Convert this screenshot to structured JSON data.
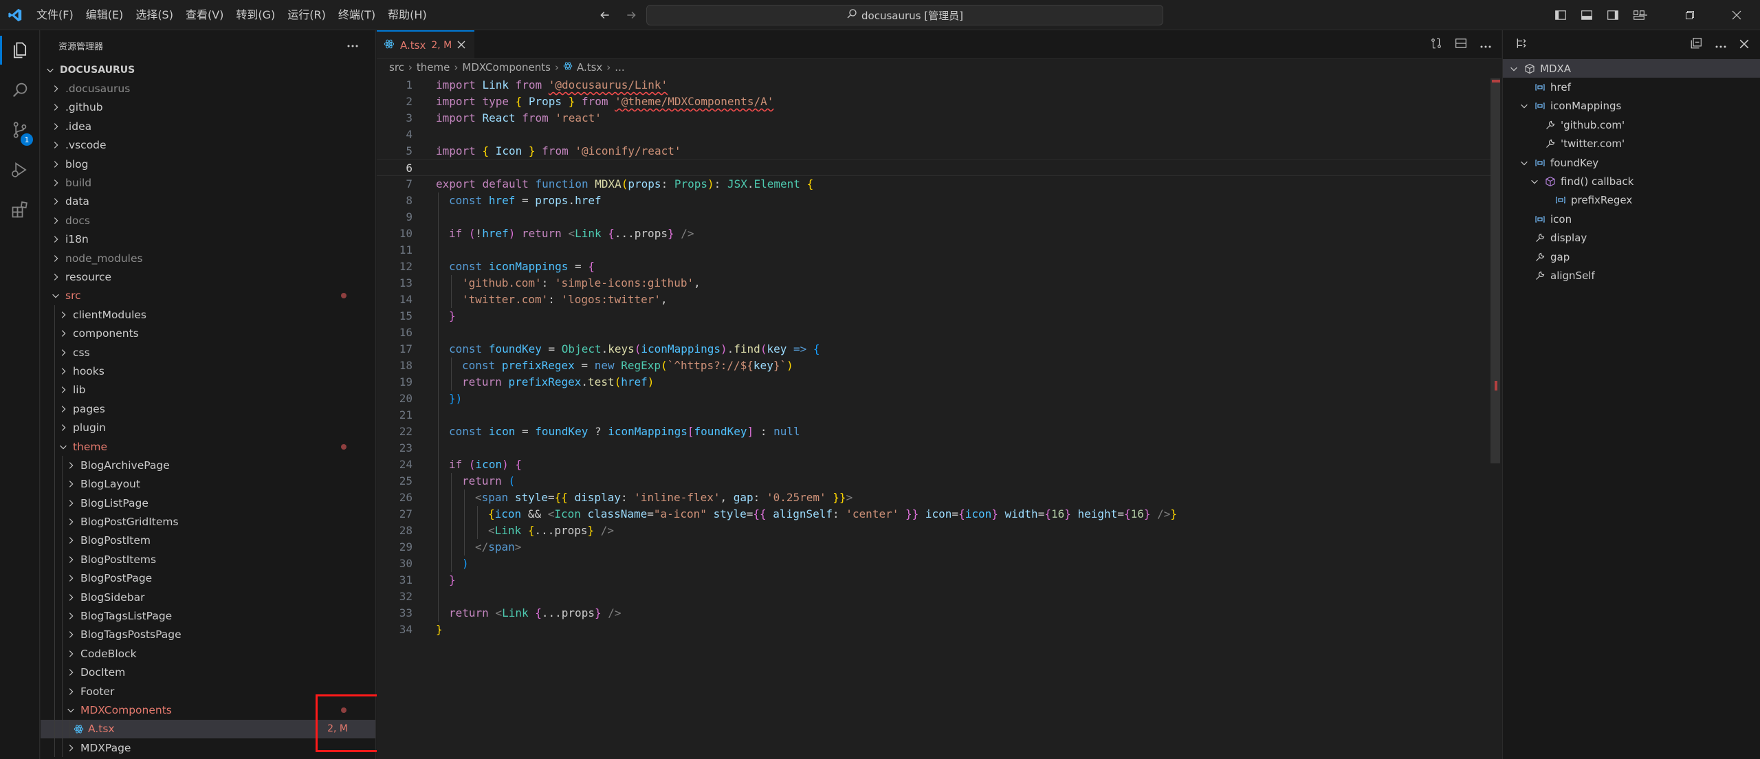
{
  "titlebar": {
    "menu": [
      "文件(F)",
      "编辑(E)",
      "选择(S)",
      "查看(V)",
      "转到(G)",
      "运行(R)",
      "终端(T)",
      "帮助(H)"
    ],
    "search": "docusaurus [管理员]"
  },
  "activity": {
    "scm_badge": "1"
  },
  "sidebar": {
    "header": "资源管理器",
    "root": "DOCUSAURUS",
    "items": [
      {
        "label": ".docusaurus",
        "depth": 1,
        "open": false,
        "dim": true
      },
      {
        "label": ".github",
        "depth": 1,
        "open": false
      },
      {
        "label": ".idea",
        "depth": 1,
        "open": false
      },
      {
        "label": ".vscode",
        "depth": 1,
        "open": false
      },
      {
        "label": "blog",
        "depth": 1,
        "open": false
      },
      {
        "label": "build",
        "depth": 1,
        "open": false,
        "dim": true
      },
      {
        "label": "data",
        "depth": 1,
        "open": false
      },
      {
        "label": "docs",
        "depth": 1,
        "open": false,
        "dim": true
      },
      {
        "label": "i18n",
        "depth": 1,
        "open": false
      },
      {
        "label": "node_modules",
        "depth": 1,
        "open": false,
        "dim": true
      },
      {
        "label": "resource",
        "depth": 1,
        "open": false
      },
      {
        "label": "src",
        "depth": 1,
        "open": true,
        "mod": true,
        "dot": true
      },
      {
        "label": "clientModules",
        "depth": 2,
        "open": false
      },
      {
        "label": "components",
        "depth": 2,
        "open": false
      },
      {
        "label": "css",
        "depth": 2,
        "open": false
      },
      {
        "label": "hooks",
        "depth": 2,
        "open": false
      },
      {
        "label": "lib",
        "depth": 2,
        "open": false
      },
      {
        "label": "pages",
        "depth": 2,
        "open": false
      },
      {
        "label": "plugin",
        "depth": 2,
        "open": false
      },
      {
        "label": "theme",
        "depth": 2,
        "open": true,
        "mod": true,
        "dot": true
      },
      {
        "label": "BlogArchivePage",
        "depth": 3,
        "open": false
      },
      {
        "label": "BlogLayout",
        "depth": 3,
        "open": false
      },
      {
        "label": "BlogListPage",
        "depth": 3,
        "open": false
      },
      {
        "label": "BlogPostGridItems",
        "depth": 3,
        "open": false
      },
      {
        "label": "BlogPostItem",
        "depth": 3,
        "open": false
      },
      {
        "label": "BlogPostItems",
        "depth": 3,
        "open": false
      },
      {
        "label": "BlogPostPage",
        "depth": 3,
        "open": false
      },
      {
        "label": "BlogSidebar",
        "depth": 3,
        "open": false
      },
      {
        "label": "BlogTagsListPage",
        "depth": 3,
        "open": false
      },
      {
        "label": "BlogTagsPostsPage",
        "depth": 3,
        "open": false
      },
      {
        "label": "CodeBlock",
        "depth": 3,
        "open": false
      },
      {
        "label": "DocItem",
        "depth": 3,
        "open": false
      },
      {
        "label": "Footer",
        "depth": 3,
        "open": false
      },
      {
        "label": "MDXComponents",
        "depth": 3,
        "open": true,
        "mod": true,
        "dot": true
      },
      {
        "label": "A.tsx",
        "depth": 4,
        "file": true,
        "mod": true,
        "selected": true,
        "status": "2, M"
      },
      {
        "label": "MDXPage",
        "depth": 3,
        "open": false
      }
    ]
  },
  "editor": {
    "tab": {
      "name": "A.tsx",
      "status": "2, M"
    },
    "breadcrumb": [
      "src",
      "theme",
      "MDXComponents",
      "A.tsx",
      "..."
    ],
    "lines": [
      "1",
      "2",
      "3",
      "4",
      "5",
      "6",
      "7",
      "8",
      "9",
      "10",
      "11",
      "12",
      "13",
      "14",
      "15",
      "16",
      "17",
      "18",
      "19",
      "20",
      "21",
      "22",
      "23",
      "24",
      "25",
      "26",
      "27",
      "28",
      "29",
      "30",
      "31",
      "32",
      "33",
      "34"
    ],
    "code": {
      "l1": [
        "import",
        "Link",
        "from",
        "'@docusaurus/Link'"
      ],
      "l2": [
        "import",
        "type",
        "{",
        "Props",
        "}",
        "from",
        "'@theme/MDXComponents/A'"
      ],
      "l3": [
        "import",
        "React",
        "from",
        "'react'"
      ],
      "l5": [
        "import",
        "{",
        "Icon",
        "}",
        "from",
        "'@iconify/react'"
      ],
      "l7": [
        "export",
        "default",
        "function",
        "MDXA",
        "(",
        "props",
        ":",
        "Props",
        ")",
        ":",
        "JSX",
        ".",
        "Element",
        "{"
      ],
      "l8": [
        "const",
        "href",
        "=",
        "props",
        ".",
        "href"
      ],
      "l10": [
        "if",
        "(",
        "!",
        "href",
        ")",
        "return",
        "<",
        "Link",
        "{",
        "...props",
        "}",
        "/>"
      ],
      "l12": [
        "const",
        "iconMappings",
        "=",
        "{"
      ],
      "l13": [
        "'github.com'",
        ":",
        "'simple-icons:github'",
        ","
      ],
      "l14": [
        "'twitter.com'",
        ":",
        "'logos:twitter'",
        ","
      ],
      "l15": [
        "}"
      ],
      "l17": [
        "const",
        "foundKey",
        "=",
        "Object",
        ".",
        "keys",
        "(",
        "iconMappings",
        ")",
        ".",
        "find",
        "(",
        "key",
        "=>",
        "{"
      ],
      "l18": [
        "const",
        "prefixRegex",
        "=",
        "new",
        "RegExp",
        "(",
        "`^https?://${",
        "key",
        "}`",
        ")"
      ],
      "l19": [
        "return",
        "prefixRegex",
        ".",
        "test",
        "(",
        "href",
        ")"
      ],
      "l20": [
        "})"
      ],
      "l22": [
        "const",
        "icon",
        "=",
        "foundKey",
        "?",
        "iconMappings",
        "[",
        "foundKey",
        "]",
        ":",
        "null"
      ],
      "l24": [
        "if",
        "(",
        "icon",
        ")",
        "{"
      ],
      "l25": [
        "return",
        "("
      ],
      "l26": [
        "<",
        "span",
        "style",
        "=",
        "{{",
        "display",
        ":",
        "'inline-flex'",
        ",",
        "gap",
        ":",
        "'0.25rem'",
        "}}",
        ">"
      ],
      "l27": [
        "{",
        "icon",
        "&&",
        "<",
        "Icon",
        "className",
        "=",
        "\"a-icon\"",
        "style",
        "=",
        "{{",
        "alignSelf",
        ":",
        "'center'",
        "}}",
        "icon",
        "=",
        "{",
        "icon",
        "}",
        "width",
        "=",
        "{",
        "16",
        "}",
        "height",
        "=",
        "{",
        "16",
        "}",
        "/>",
        "}"
      ],
      "l28": [
        "<",
        "Link",
        "{",
        "...props",
        "}",
        "/>"
      ],
      "l29": [
        "</",
        "span",
        ">"
      ],
      "l30": [
        ")"
      ],
      "l31": [
        "}"
      ],
      "l33": [
        "return",
        "<",
        "Link",
        "{",
        "...props",
        "}",
        "/>"
      ],
      "l34": [
        "}"
      ]
    }
  },
  "outline": {
    "items": [
      {
        "label": "MDXA",
        "depth": 0,
        "icon": "module-icon",
        "open": true,
        "selected": true
      },
      {
        "label": "href",
        "depth": 1,
        "icon": "variable-icon"
      },
      {
        "label": "iconMappings",
        "depth": 1,
        "icon": "variable-icon",
        "open": true
      },
      {
        "label": "'github.com'",
        "depth": 2,
        "icon": "property-icon"
      },
      {
        "label": "'twitter.com'",
        "depth": 2,
        "icon": "property-icon"
      },
      {
        "label": "foundKey",
        "depth": 1,
        "icon": "variable-icon",
        "open": true
      },
      {
        "label": "find() callback",
        "depth": 2,
        "icon": "method-icon",
        "open": true
      },
      {
        "label": "prefixRegex",
        "depth": 3,
        "icon": "variable-icon"
      },
      {
        "label": "icon",
        "depth": 1,
        "icon": "variable-icon"
      },
      {
        "label": "display",
        "depth": 1,
        "icon": "property-icon"
      },
      {
        "label": "gap",
        "depth": 1,
        "icon": "property-icon"
      },
      {
        "label": "alignSelf",
        "depth": 1,
        "icon": "property-icon"
      }
    ]
  }
}
